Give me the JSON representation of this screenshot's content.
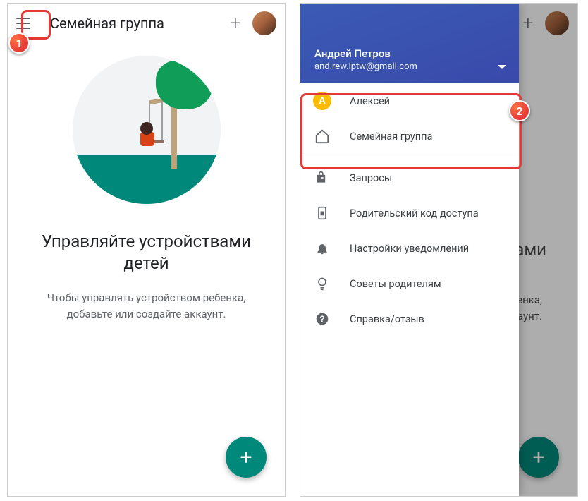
{
  "left": {
    "appbar_title": "Семейная группа",
    "headline": "Управляйте устройствами детей",
    "subline": "Чтобы управлять устройством ребенка, добавьте или создайте аккаунт."
  },
  "right": {
    "appbar_title": "Семейная группа",
    "headline_partial": "твами",
    "sub_partial1": "ребенка,",
    "sub_partial2": "аунт."
  },
  "drawer": {
    "user_name": "Андрей Петров",
    "user_email": "and.rew.lptw@gmail.com",
    "items": [
      {
        "label": "Алексей"
      },
      {
        "label": "Семейная группа"
      },
      {
        "label": "Запросы"
      },
      {
        "label": "Родительский код доступа"
      },
      {
        "label": "Настройки уведомлений"
      },
      {
        "label": "Советы родителям"
      },
      {
        "label": "Справка/отзыв"
      }
    ]
  },
  "badges": {
    "one": "1",
    "two": "2"
  }
}
